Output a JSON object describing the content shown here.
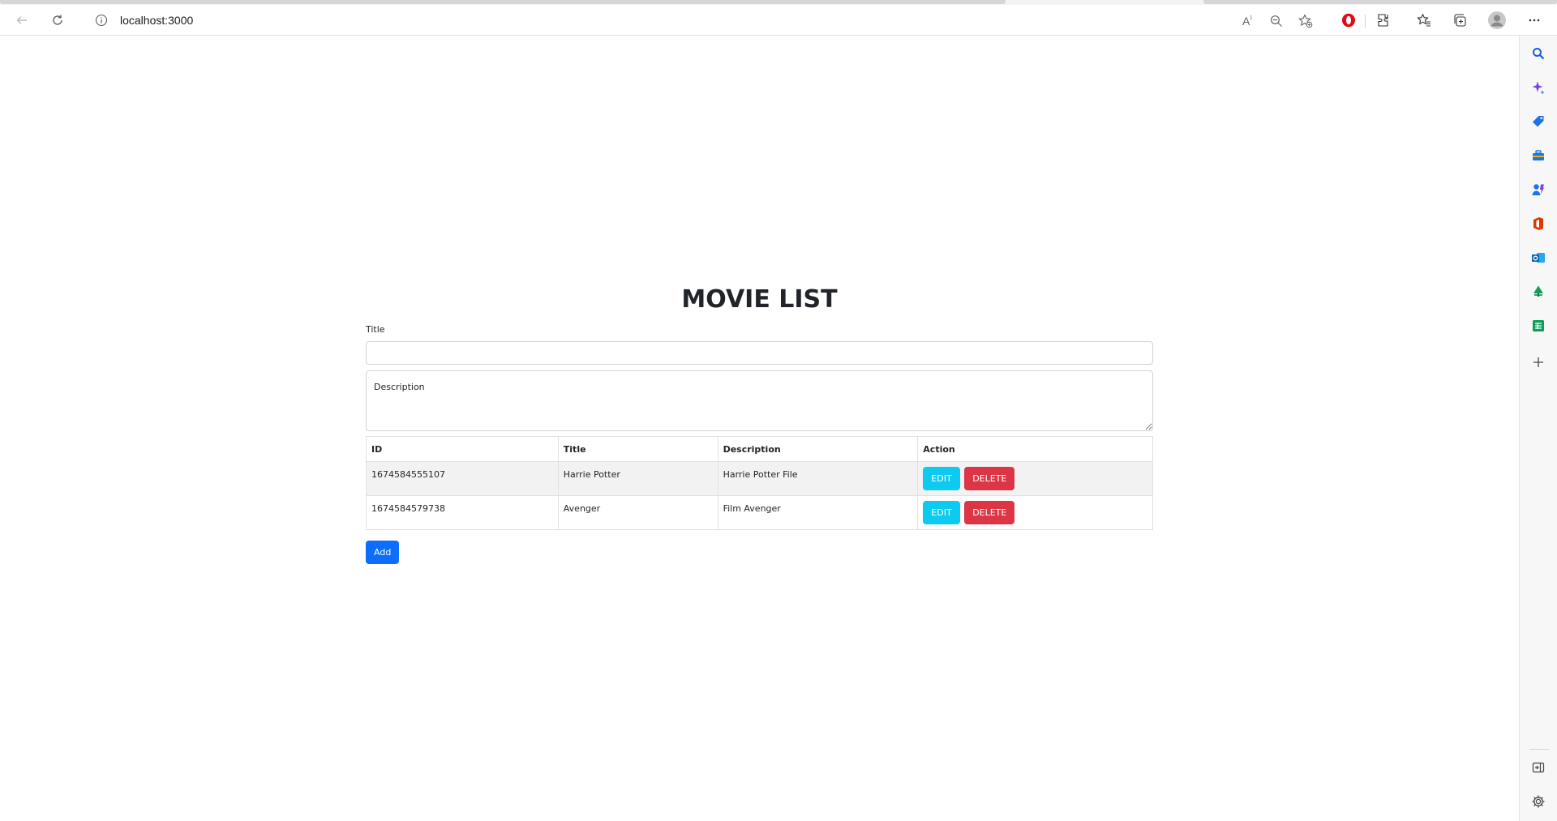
{
  "browser": {
    "url": "localhost:3000",
    "back_icon": "back-arrow-icon",
    "refresh_icon": "refresh-icon",
    "info_icon": "info-icon",
    "read_aloud_icon": "read-aloud-icon",
    "read_aloud_label": "A",
    "zoom_icon": "zoom-out-icon",
    "favorite_icon": "add-favorite-icon",
    "extensions": [
      "opera-icon",
      "extensions-icon",
      "favorites-icon",
      "collections-icon",
      "profile-icon",
      "more-icon"
    ],
    "sidebar_icons": [
      "search-icon",
      "copilot-icon",
      "shopping-icon",
      "tools-icon",
      "games-icon",
      "office-icon",
      "outlook-icon",
      "tree-icon",
      "sheets-icon",
      "add-icon",
      "hide-sidebar-icon",
      "settings-icon"
    ]
  },
  "page": {
    "title": "MOVIE LIST",
    "form": {
      "title_label": "Title",
      "title_value": "",
      "description_placeholder": "Description"
    },
    "table": {
      "headers": [
        "ID",
        "Title",
        "Description",
        "Action"
      ],
      "rows": [
        {
          "id": "1674584555107",
          "title": "Harrie Potter",
          "description": "Harrie Potter File"
        },
        {
          "id": "1674584579738",
          "title": "Avenger",
          "description": "Film Avenger"
        }
      ],
      "edit_label": "EDIT",
      "delete_label": "DELETE"
    },
    "add_label": "Add"
  },
  "colors": {
    "edit": "#0dcaf0",
    "delete": "#dc3545",
    "add": "#0d6efd",
    "row_stripe": "#f2f2f2"
  }
}
